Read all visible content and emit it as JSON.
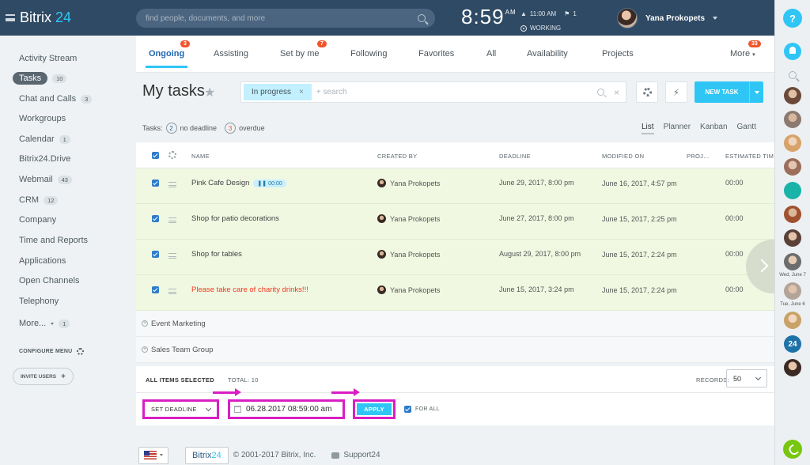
{
  "topbar": {
    "logo_text": "Bitrix",
    "logo_num": "24",
    "search_placeholder": "find people, documents, and more",
    "clock": "8:59",
    "ampm": "AM",
    "alarm_time": "11:00 AM",
    "flag_count": "1",
    "status": "WORKING",
    "user_name": "Yana Prokopets"
  },
  "rail": {
    "help": "?",
    "date1": "Wed, June 7",
    "date2": "Tue, June 6",
    "b24": "24"
  },
  "leftnav": {
    "items": [
      {
        "label": "Activity Stream",
        "count": ""
      },
      {
        "label": "Tasks",
        "count": "10"
      },
      {
        "label": "Chat and Calls",
        "count": "3"
      },
      {
        "label": "Workgroups",
        "count": ""
      },
      {
        "label": "Calendar",
        "count": "1"
      },
      {
        "label": "Bitrix24.Drive",
        "count": ""
      },
      {
        "label": "Webmail",
        "count": "43"
      },
      {
        "label": "CRM",
        "count": "12"
      },
      {
        "label": "Company",
        "count": ""
      },
      {
        "label": "Time and Reports",
        "count": ""
      },
      {
        "label": "Applications",
        "count": ""
      },
      {
        "label": "Open Channels",
        "count": ""
      },
      {
        "label": "Telephony",
        "count": ""
      },
      {
        "label": "More...",
        "count": "1"
      }
    ],
    "configure": "CONFIGURE MENU",
    "invite": "INVITE USERS"
  },
  "tabs": [
    {
      "label": "Ongoing",
      "badge": "3"
    },
    {
      "label": "Assisting",
      "badge": ""
    },
    {
      "label": "Set by me",
      "badge": "7"
    },
    {
      "label": "Following",
      "badge": ""
    },
    {
      "label": "Favorites",
      "badge": ""
    },
    {
      "label": "All",
      "badge": ""
    },
    {
      "label": "Availability",
      "badge": ""
    },
    {
      "label": "Projects",
      "badge": ""
    },
    {
      "label": "More",
      "badge": "33"
    }
  ],
  "header": {
    "title": "My tasks",
    "filter_chip": "In progress",
    "filter_placeholder": "+ search",
    "new_task": "NEW TASK"
  },
  "counters": {
    "prefix": "Tasks:",
    "no_deadline_count": "2",
    "no_deadline_label": "no deadline",
    "overdue_count": "3",
    "overdue_label": "overdue"
  },
  "views": [
    "List",
    "Planner",
    "Kanban",
    "Gantt"
  ],
  "columns": {
    "name": "NAME",
    "created_by": "CREATED BY",
    "deadline": "DEADLINE",
    "modified_on": "MODIFIED ON",
    "project": "PROJ...",
    "estimated": "ESTIMATED TIM"
  },
  "rows": [
    {
      "name": "Pink Cafe Design",
      "timer": "00:00",
      "creator": "Yana Prokopets",
      "deadline": "June 29, 2017, 8:00 pm",
      "modified": "June 16, 2017, 4:57 pm",
      "estimated": "00:00",
      "overdue": false
    },
    {
      "name": "Shop for patio decorations",
      "timer": "",
      "creator": "Yana Prokopets",
      "deadline": "June 27, 2017, 8:00 pm",
      "modified": "June 15, 2017, 2:25 pm",
      "estimated": "00:00",
      "overdue": false
    },
    {
      "name": "Shop for tables",
      "timer": "",
      "creator": "Yana Prokopets",
      "deadline": "August 29, 2017, 8:00 pm",
      "modified": "June 15, 2017, 2:24 pm",
      "estimated": "00:00",
      "overdue": false
    },
    {
      "name": "Please take care of charity drinks!!!",
      "timer": "",
      "creator": "Yana Prokopets",
      "deadline": "June 15, 2017, 3:24 pm",
      "modified": "June 15, 2017, 2:24 pm",
      "estimated": "00:00",
      "overdue": true
    }
  ],
  "groups": [
    "Event Marketing",
    "Sales Team Group"
  ],
  "footer": {
    "all_selected": "ALL ITEMS SELECTED",
    "total": "TOTAL: 10",
    "records_label": "RECORDS:",
    "records_value": "50",
    "set_deadline": "SET DEADLINE",
    "deadline_value": "06.28.2017 08:59:00 am",
    "apply": "APPLY",
    "for_all": "FOR ALL"
  },
  "bottom": {
    "logo_a": "Bitrix",
    "logo_b": "24",
    "copyright": "© 2001-2017 Bitrix, Inc.",
    "support": "Support24"
  },
  "colors": {
    "accent": "#2fc6f6",
    "header_bg": "#2f4a64",
    "highlight": "#d91ec4",
    "badge": "#f0562d",
    "row_bg": "#f0f8e2"
  }
}
